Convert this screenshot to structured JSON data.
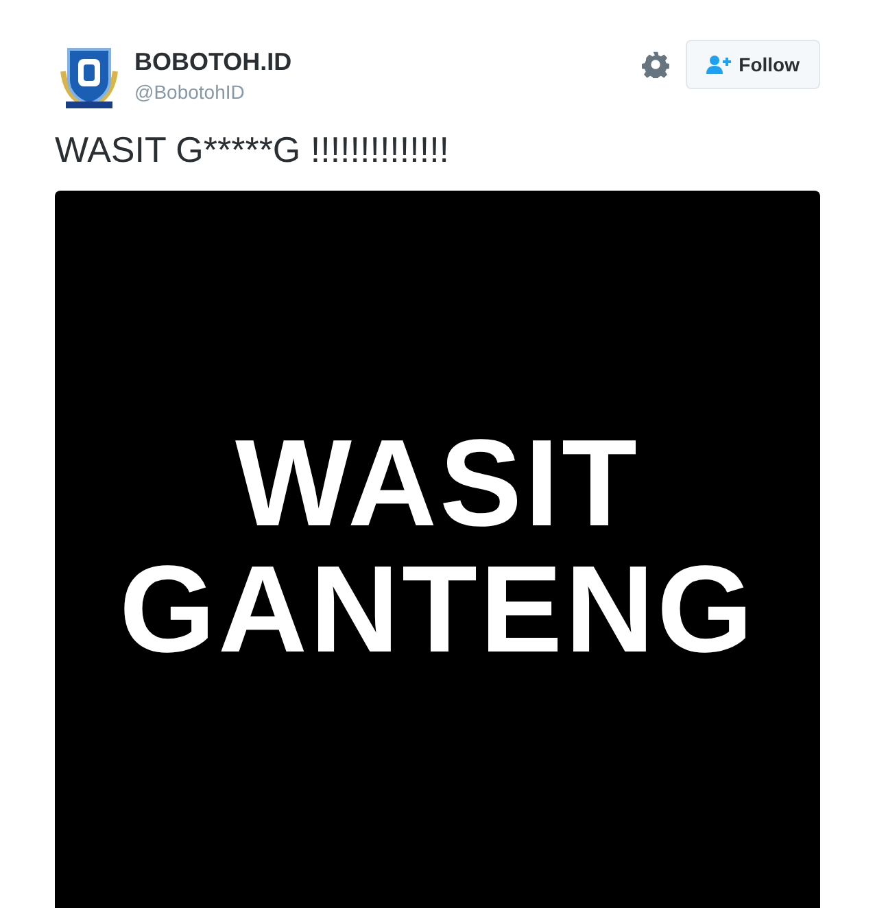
{
  "author": {
    "name": "BOBOTOH.ID",
    "handle": "@BobotohID"
  },
  "follow_button": {
    "label": "Follow"
  },
  "tweet_text": "WASIT G*****G !!!!!!!!!!!!!!",
  "media": {
    "lines": [
      "WASIT",
      "GANTENG"
    ]
  }
}
